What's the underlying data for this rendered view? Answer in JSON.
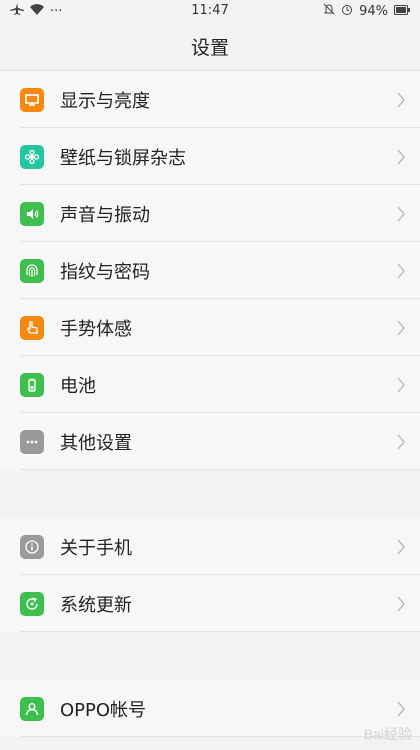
{
  "status": {
    "time": "11:47",
    "battery": "94%",
    "dots": "···"
  },
  "title": "设置",
  "groups": [
    {
      "items": [
        {
          "label": "显示与亮度",
          "icon": "display-icon",
          "color": "#f58a12"
        },
        {
          "label": "壁纸与锁屏杂志",
          "icon": "wallpaper-icon",
          "color": "#26c6a0"
        },
        {
          "label": "声音与振动",
          "icon": "sound-icon",
          "color": "#3fbf4f"
        },
        {
          "label": "指纹与密码",
          "icon": "fingerprint-icon",
          "color": "#3fbf4f"
        },
        {
          "label": "手势体感",
          "icon": "gesture-icon",
          "color": "#f58a12"
        },
        {
          "label": "电池",
          "icon": "battery-icon",
          "color": "#3fbf4f"
        },
        {
          "label": "其他设置",
          "icon": "more-icon",
          "color": "#9a9a9a"
        }
      ]
    },
    {
      "items": [
        {
          "label": "关于手机",
          "icon": "info-icon",
          "color": "#9a9a9a"
        },
        {
          "label": "系统更新",
          "icon": "update-icon",
          "color": "#3fbf4f"
        }
      ]
    },
    {
      "items": [
        {
          "label": "OPPO帐号",
          "icon": "account-icon",
          "color": "#3fbf4f"
        }
      ]
    }
  ],
  "watermark": "Bai经验"
}
